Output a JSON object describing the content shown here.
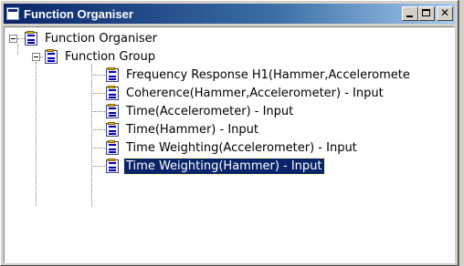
{
  "window": {
    "title": "Function Organiser"
  },
  "tree": {
    "root": {
      "label": "Function Organiser"
    },
    "group": {
      "label": "Function Group"
    },
    "items": [
      {
        "label": "Frequency Response H1(Hammer,Acceleromete"
      },
      {
        "label": "Coherence(Hammer,Accelerometer) - Input"
      },
      {
        "label": "Time(Accelerometer) - Input"
      },
      {
        "label": "Time(Hammer) - Input"
      },
      {
        "label": "Time Weighting(Accelerometer) - Input"
      },
      {
        "label": "Time Weighting(Hammer) - Input"
      }
    ],
    "selected_index": 5
  },
  "colors": {
    "titlebar_start": "#0a246a",
    "titlebar_end": "#a6caf0",
    "selection": "#0a246a",
    "window_face": "#d4d0c8"
  },
  "icons": {
    "node": "function-document-icon",
    "expander": "collapse-minus-icon"
  }
}
